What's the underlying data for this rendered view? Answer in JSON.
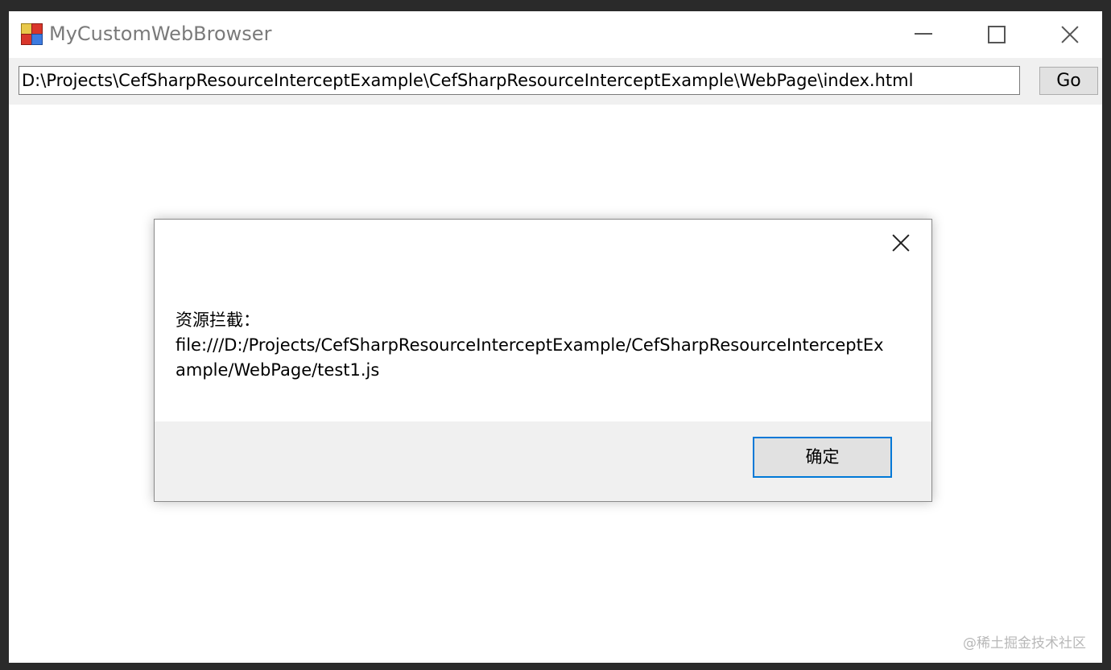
{
  "window": {
    "title": "MyCustomWebBrowser",
    "icon": "app-icon"
  },
  "toolbar": {
    "address_value": "D:\\Projects\\CefSharpResourceInterceptExample\\CefSharpResourceInterceptExample\\WebPage\\index.html",
    "go_label": "Go"
  },
  "dialog": {
    "message_line1": "资源拦截：",
    "message_line2": "file:///D:/Projects/CefSharpResourceInterceptExample/CefSharpResourceInterceptExample/WebPage/test1.js",
    "ok_label": "确定",
    "accent_color": "#0078d7"
  },
  "watermark": "@稀土掘金技术社区"
}
